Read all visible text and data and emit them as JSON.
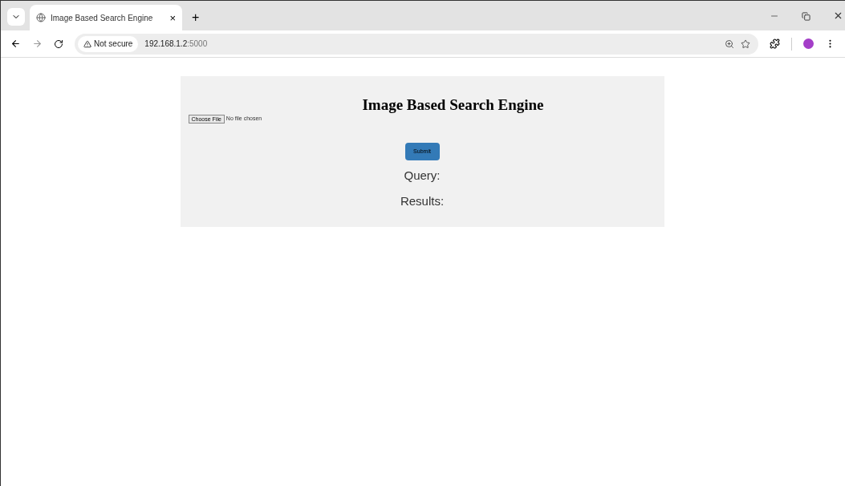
{
  "tab": {
    "title": "Image Based Search Engine",
    "close": "×",
    "new_tab": "+",
    "selected": true
  },
  "address_bar": {
    "security": "Not secure",
    "host": "192.168.1.2",
    "port": ":5000"
  },
  "page": {
    "heading": "Image Based Search Engine",
    "file_button": "Choose File",
    "file_status": "No file chosen",
    "submit": "Submit",
    "query_label": "Query:",
    "results_label": "Results:"
  }
}
